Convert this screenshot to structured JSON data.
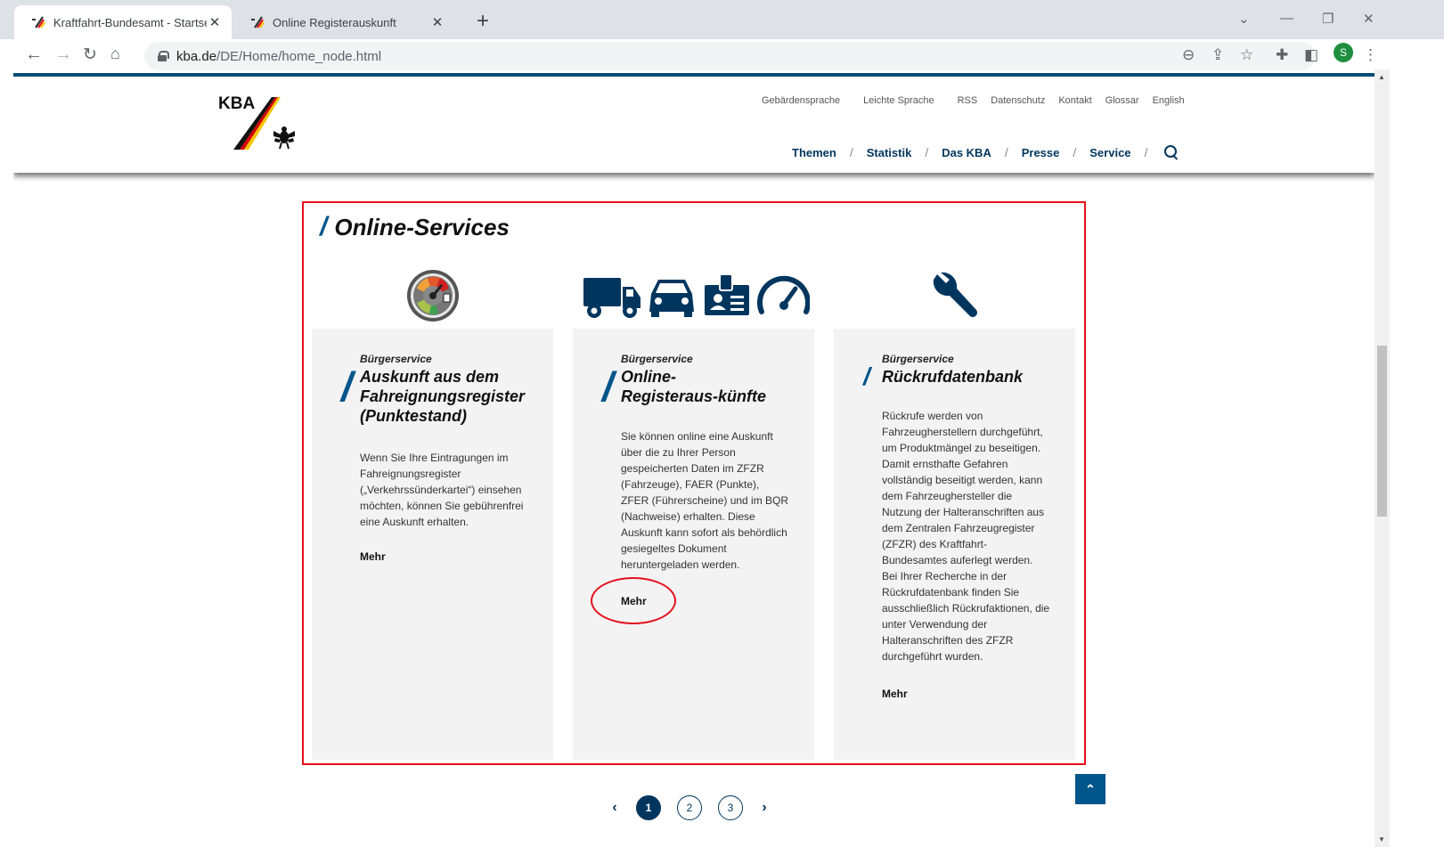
{
  "browser": {
    "tabs": [
      {
        "title": "Kraftfahrt-Bundesamt - Startseite",
        "active": true
      },
      {
        "title": "Online Registerauskunft",
        "active": false
      }
    ],
    "url_host": "kba.de",
    "url_path": "/DE/Home/home_node.html",
    "profile_initial": "S"
  },
  "header": {
    "logo_text": "KBA",
    "util_nav": [
      "Gebärdensprache",
      "Leichte Sprache",
      "RSS",
      "Datenschutz",
      "Kontakt",
      "Glossar",
      "English"
    ],
    "main_nav": [
      "Themen",
      "Statistik",
      "Das KBA",
      "Presse",
      "Service"
    ]
  },
  "section": {
    "title": "Online-Services",
    "cards": [
      {
        "kicker": "Bürgerservice",
        "title": "Auskunft aus dem Fahreignungsregister (Punktestand)",
        "text": "Wenn Sie Ihre Eintragungen im Fahreignungsregister („Verkehrssünderkartei“) einsehen möchten, können Sie gebührenfrei eine Auskunft erhalten.",
        "more": "Mehr",
        "icon": "gauge-points-icon"
      },
      {
        "kicker": "Bürgerservice",
        "title": "Online-Registeraus-künfte",
        "text": "Sie können online eine Auskunft über die zu Ihrer Person gespeicherten Daten im ZFZR (Fahrzeuge), FAER (Punkte), ZFER (Führerscheine) und im BQR (Nachweise) erhalten. Diese Auskunft kann sofort als behördlich gesiegeltes Dokument heruntergeladen werden.",
        "more": "Mehr",
        "icon": "vehicle-register-icons"
      },
      {
        "kicker": "Bürgerservice",
        "title": "Rückrufdatenbank",
        "text": "Rückrufe werden von Fahrzeugherstellern durchgeführt, um Produktmängel zu beseitigen. Damit ernsthafte Gefahren vollständig beseitigt werden, kann dem Fahrzeughersteller die Nutzung der Halteranschriften aus dem Zentralen Fahrzeugregister (ZFZR) des Kraftfahrt-Bundesamtes auferlegt werden. Bei Ihrer Recherche in der Rückrufdatenbank finden Sie ausschließlich Rückrufaktionen, die unter Verwendung der Halteranschriften des ZFZR durchgeführt wurden.",
        "more": "Mehr",
        "icon": "wrench-icon"
      }
    ]
  },
  "pager": {
    "pages": [
      "1",
      "2",
      "3"
    ],
    "current": "1"
  },
  "colors": {
    "accent": "#00558a",
    "nav": "#00365e",
    "annotation": "#e3101b"
  }
}
